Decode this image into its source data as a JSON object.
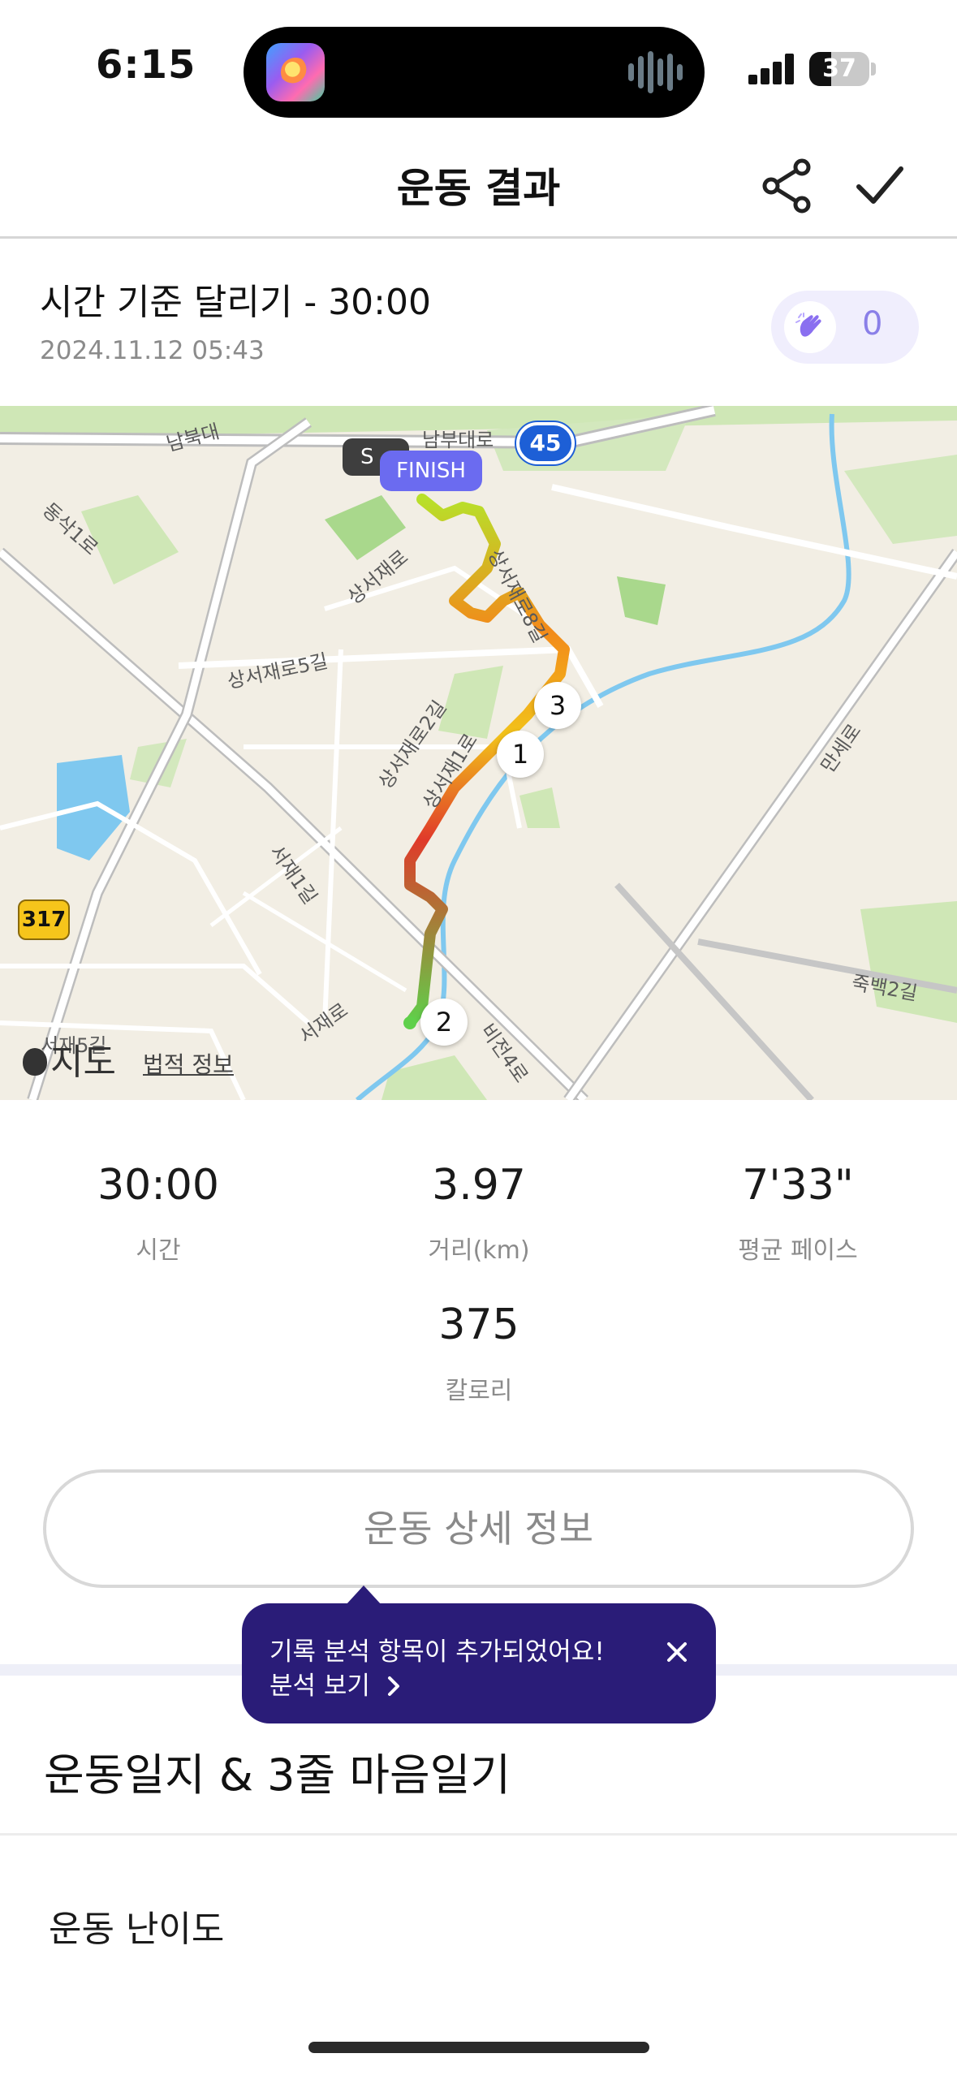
{
  "status_bar": {
    "time": "6:15",
    "battery": "37",
    "battery_level": 0.37
  },
  "header": {
    "title": "운동 결과",
    "share_icon": "share-icon",
    "confirm_icon": "check-icon"
  },
  "workout": {
    "title": "시간 기준 달리기 - 30:00",
    "date": "2024.11.12 05:43",
    "clap_count": "0",
    "clap_icon": "clap-icon"
  },
  "map": {
    "finish_label": "FINISH",
    "start_label": "S",
    "road_badge_highway": "45",
    "road_badge_local": "317",
    "markers": [
      "1",
      "2",
      "3"
    ],
    "labels": {
      "sangseo_ro": "상서재로",
      "sangseo_8gil": "상서재로8길",
      "sangseo_5gil": "상서재로5길",
      "sangseo_2gil": "상서재로2길",
      "sangseo_1ro": "상서재1로",
      "dongsa_1ro": "동삭1로",
      "seojae_1gil": "서재1길",
      "seojae_ro": "서재로",
      "bijeon_4ro": "비전4로",
      "manse_ro": "만세로",
      "jukbaek_2gil": "죽백2길",
      "seojae_5gil": "서재5길",
      "nambu": "남북대",
      "top_road": "남부대로"
    },
    "attribution": "지도",
    "legal": "법적 정보"
  },
  "stats": [
    {
      "value": "30:00",
      "label": "시간"
    },
    {
      "value": "3.97",
      "label": "거리(km)"
    },
    {
      "value": "7'33\"",
      "label": "평균 페이스"
    },
    {
      "value": "375",
      "label": "칼로리"
    }
  ],
  "detail_button": "운동 상세 정보",
  "tooltip": {
    "message": "기록 분석 항목이 추가되었어요!",
    "link": "분석 보기"
  },
  "journal": {
    "title": "운동일지 & 3줄 마음일기",
    "difficulty": "운동 난이도"
  },
  "colors": {
    "accent": "#6b6bf0",
    "tooltip_bg": "#2a1c78",
    "route_slow": "#e03a2a",
    "route_fast": "#5fd04a"
  }
}
